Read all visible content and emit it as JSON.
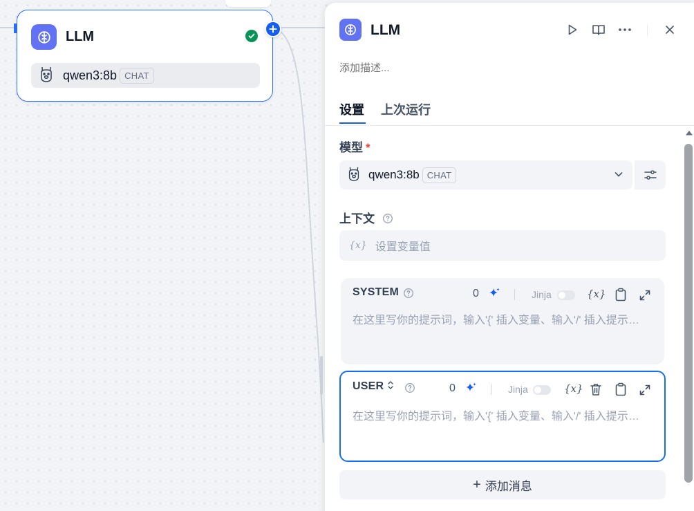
{
  "canvas_node": {
    "title": "LLM",
    "model_name": "qwen3:8b",
    "model_badge": "CHAT"
  },
  "panel": {
    "title": "LLM",
    "description_placeholder": "添加描述...",
    "tabs": [
      {
        "label": "设置",
        "active": true
      },
      {
        "label": "上次运行",
        "active": false
      }
    ],
    "model_section": {
      "label": "模型",
      "required_mark": "*",
      "model_name": "qwen3:8b",
      "model_badge": "CHAT"
    },
    "context_section": {
      "label": "上下文",
      "var_icon": "{x}",
      "placeholder": "设置变量值"
    },
    "system_prompt": {
      "role": "SYSTEM",
      "count": "0",
      "jinja_label": "Jinja",
      "var_button": "{x}",
      "placeholder": "在这里写你的提示词，输入'{' 插入变量、输入'/' 插入提示内容块"
    },
    "user_prompt": {
      "role": "USER",
      "count": "0",
      "jinja_label": "Jinja",
      "var_button": "{x}",
      "placeholder": "在这里写你的提示词，输入'{' 插入变量、输入'/' 插入提示内容块"
    },
    "add_message": {
      "plus": "+",
      "label": "添加消息"
    }
  },
  "colors": {
    "accent": "#155eef",
    "node_icon_bg": "#6172f3",
    "success": "#079455",
    "required": "#f04438"
  },
  "icons": [
    "brain-icon",
    "check-circle-icon",
    "plus-icon",
    "llama-icon",
    "play-icon",
    "book-icon",
    "more-icon",
    "close-icon",
    "help-icon",
    "chevron-down-icon",
    "sliders-icon",
    "sparkle-icon",
    "copy-icon",
    "expand-icon",
    "trash-icon",
    "sort-icon"
  ]
}
